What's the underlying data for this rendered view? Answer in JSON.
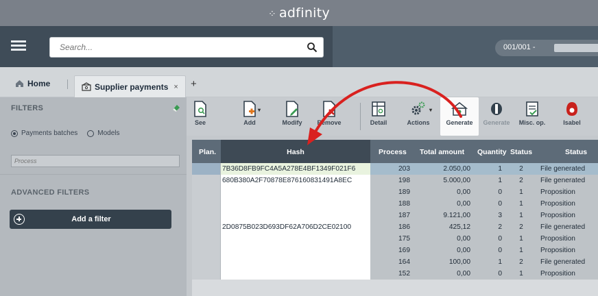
{
  "app": {
    "brand": "adfinity"
  },
  "header": {
    "search_placeholder": "Search...",
    "company": "001/001 -"
  },
  "tabs": {
    "home": "Home",
    "active": "Supplier payments",
    "close": "×",
    "add": "+"
  },
  "filters": {
    "title": "FILTERS",
    "radio_batches": "Payments batches",
    "radio_models": "Models",
    "process_placeholder": "Process",
    "advanced_title": "ADVANCED FILTERS",
    "add_filter": "Add a filter"
  },
  "toolbar": {
    "see": "See",
    "add": "Add",
    "modify": "Modify",
    "remove": "Remove",
    "detail": "Detail",
    "actions": "Actions",
    "generate": "Generate",
    "generate2": "Generate",
    "misc": "Misc. op.",
    "isabel": "Isabel"
  },
  "grid": {
    "columns": {
      "plan": "Plan.",
      "hash": "Hash",
      "process": "Process",
      "amount": "Total amount",
      "quantity": "Quantity",
      "status": "Status",
      "status_text": "Status"
    },
    "rows": [
      {
        "hash": "7B36D8FB9FC4A5A278E4BF1349F021F6",
        "process": "203",
        "amount": "2.050,00",
        "quantity": "1",
        "status": "2",
        "status_text": "File generated"
      },
      {
        "hash": "680B380A2F70878E876160831491A8EC",
        "process": "198",
        "amount": "5.000,00",
        "quantity": "1",
        "status": "2",
        "status_text": "File generated"
      },
      {
        "hash": "",
        "process": "189",
        "amount": "0,00",
        "quantity": "0",
        "status": "1",
        "status_text": "Proposition"
      },
      {
        "hash": "",
        "process": "188",
        "amount": "0,00",
        "quantity": "0",
        "status": "1",
        "status_text": "Proposition"
      },
      {
        "hash": "",
        "process": "187",
        "amount": "9.121,00",
        "quantity": "3",
        "status": "1",
        "status_text": "Proposition"
      },
      {
        "hash": "2D0875B023D693DF62A706D2CE02100",
        "process": "186",
        "amount": "425,12",
        "quantity": "2",
        "status": "2",
        "status_text": "File generated"
      },
      {
        "hash": "",
        "process": "175",
        "amount": "0,00",
        "quantity": "0",
        "status": "1",
        "status_text": "Proposition"
      },
      {
        "hash": "",
        "process": "169",
        "amount": "0,00",
        "quantity": "0",
        "status": "1",
        "status_text": "Proposition"
      },
      {
        "hash": "",
        "process": "164",
        "amount": "100,00",
        "quantity": "1",
        "status": "2",
        "status_text": "File generated"
      },
      {
        "hash": "",
        "process": "152",
        "amount": "0,00",
        "quantity": "0",
        "status": "1",
        "status_text": "Proposition"
      }
    ]
  },
  "colors": {
    "annotation_arrow": "#d9211f",
    "header_bg": "#5d6b78",
    "selected_row": "#a8bdd0"
  }
}
